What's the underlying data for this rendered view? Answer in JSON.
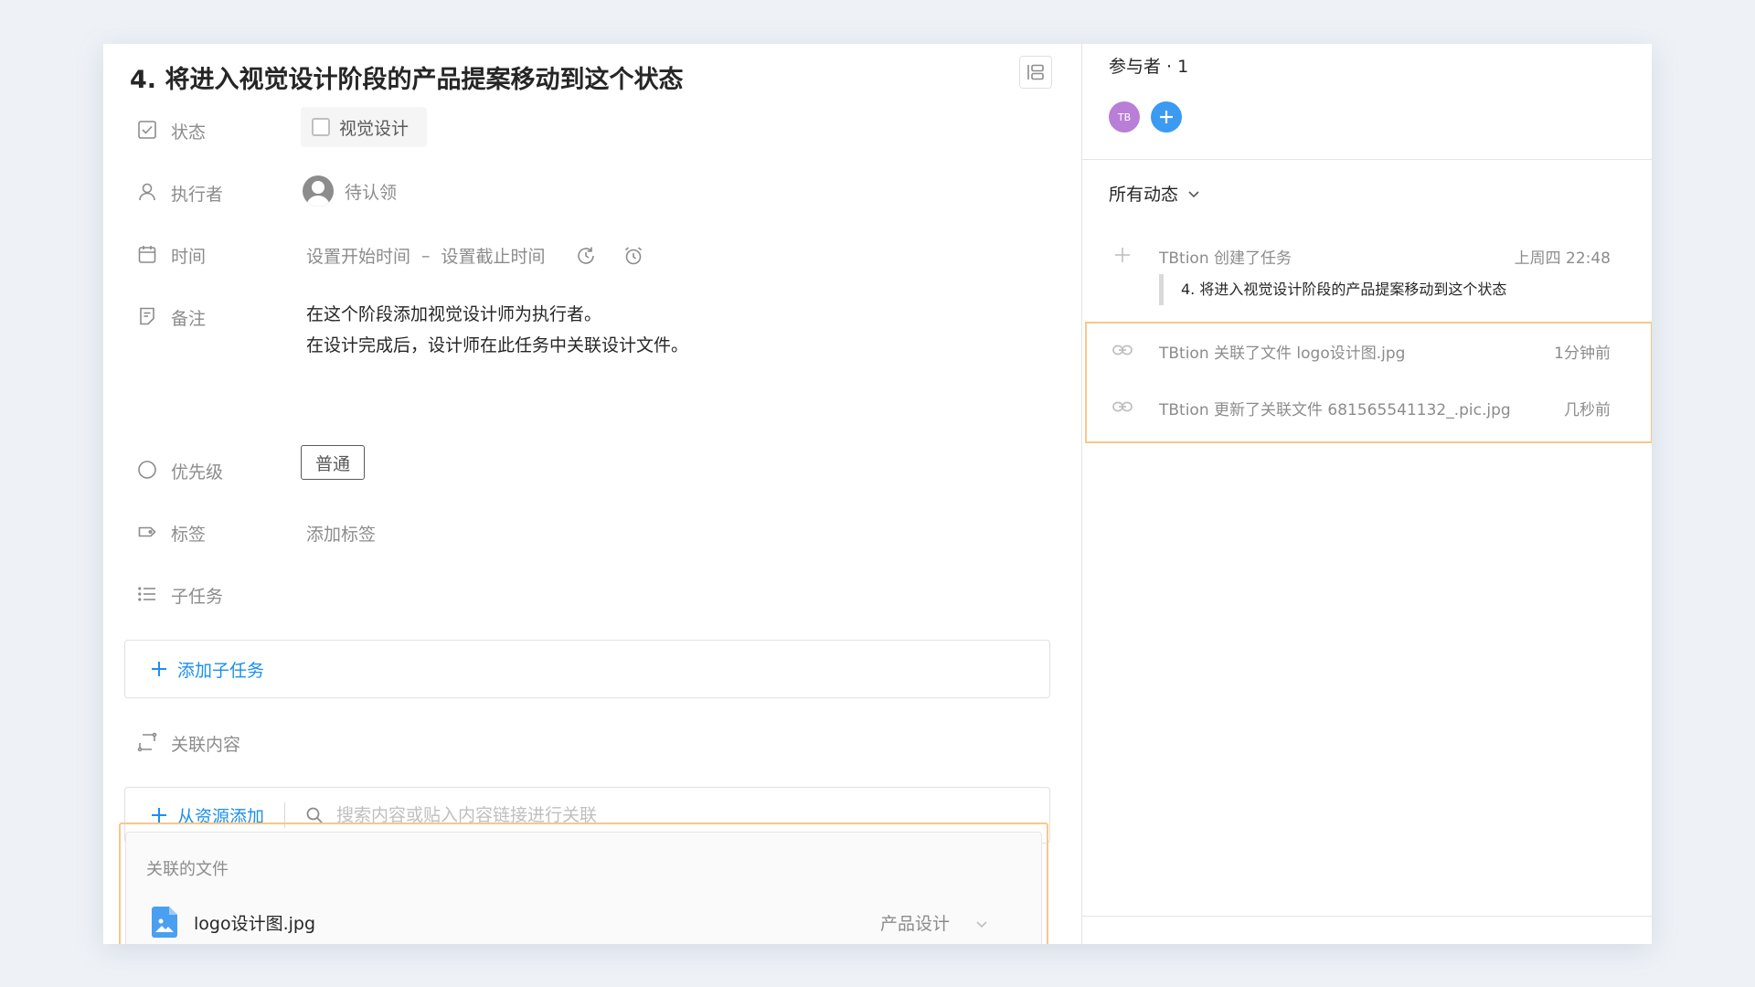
{
  "task": {
    "title": "4. 将进入视觉设计阶段的产品提案移动到这个状态",
    "fields": {
      "status": {
        "label": "状态",
        "value": "视觉设计"
      },
      "assignee": {
        "label": "执行者",
        "value": "待认领"
      },
      "time": {
        "label": "时间",
        "start": "设置开始时间",
        "separator": "–",
        "end": "设置截止时间"
      },
      "note": {
        "label": "备注",
        "line1": "在这个阶段添加视觉设计师为执行者。",
        "line2": "在设计完成后，设计师在此任务中关联设计文件。"
      },
      "priority": {
        "label": "优先级",
        "value": "普通"
      },
      "tags": {
        "label": "标签",
        "placeholder": "添加标签"
      },
      "subtasks": {
        "label": "子任务",
        "add_label": "添加子任务"
      },
      "relations": {
        "label": "关联内容",
        "add_label": "从资源添加",
        "search_placeholder": "搜索内容或贴入内容链接进行关联"
      }
    },
    "linked_files": {
      "header": "关联的文件",
      "items": [
        {
          "name": "logo设计图.jpg",
          "project": "产品设计",
          "icon": "image-file-icon"
        }
      ]
    }
  },
  "sidebar": {
    "participants_label": "参与者 · 1",
    "participants": [
      {
        "initials": "TB",
        "color": "#b97fd6"
      }
    ],
    "filter_label": "所有动态",
    "activities": [
      {
        "icon": "plus-icon",
        "text": "TBtion 创建了任务",
        "time": "上周四 22:48",
        "detail": "4. 将进入视觉设计阶段的产品提案移动到这个状态"
      },
      {
        "icon": "link-icon",
        "text": "TBtion 关联了文件 logo设计图.jpg",
        "time": "1分钟前"
      },
      {
        "icon": "link-icon",
        "text": "TBtion 更新了关联文件 681565541132_.pic.jpg",
        "time": "几秒前"
      }
    ]
  },
  "colors": {
    "accent": "#1b8ff0",
    "highlight": "#f8c78a",
    "avatar_tb": "#b97fd6",
    "add_button": "#3b9af2"
  }
}
